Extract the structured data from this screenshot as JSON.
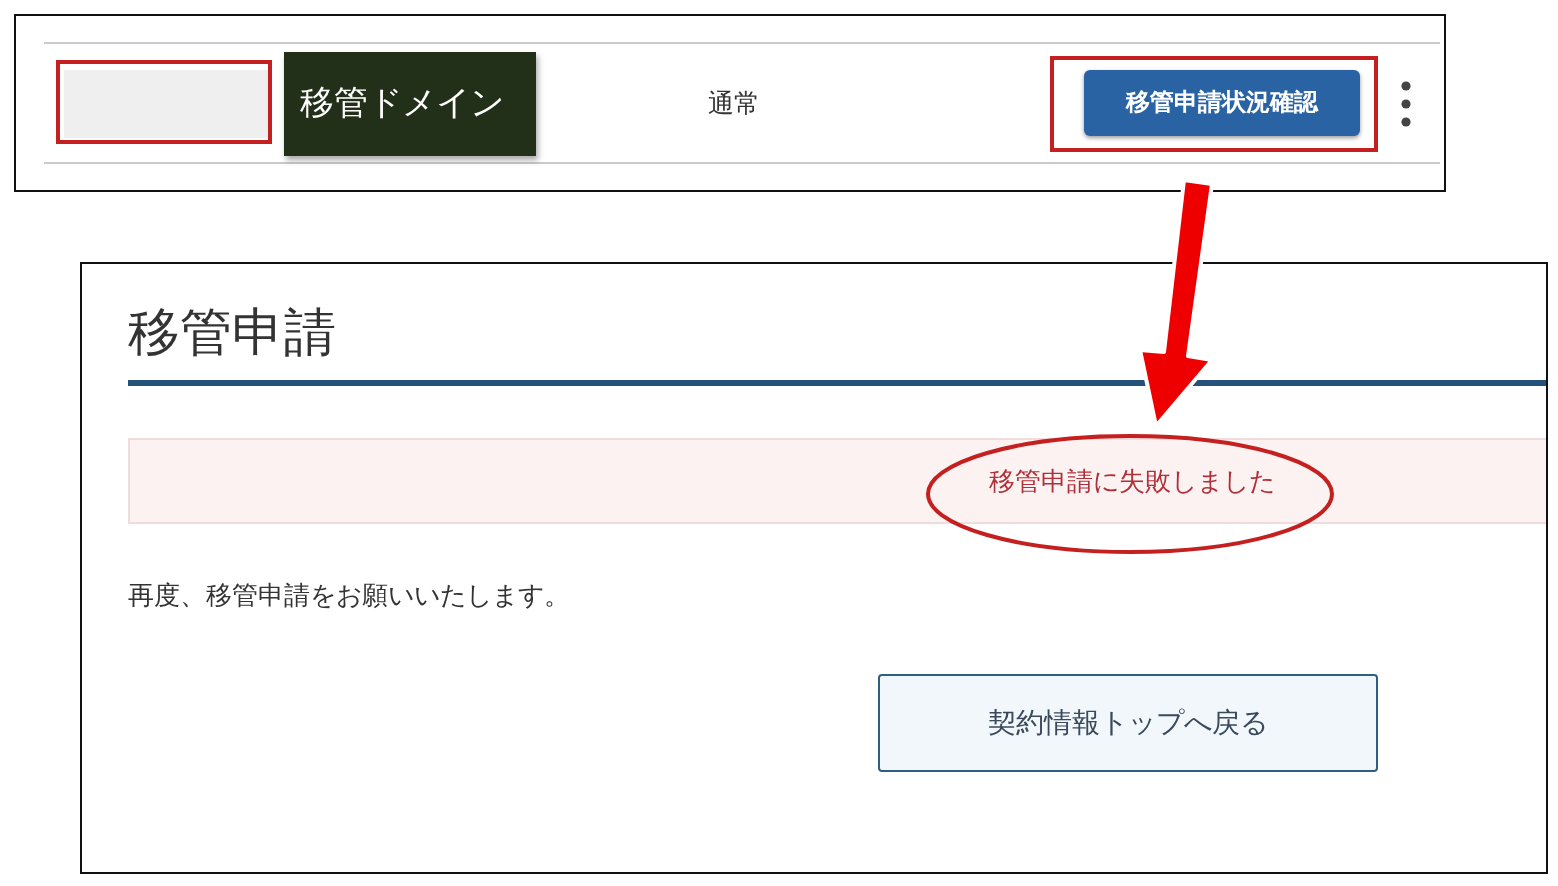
{
  "domain_row": {
    "domain_label": "移管ドメイン",
    "status": "通常",
    "status_button": "移管申請状況確認"
  },
  "transfer_result": {
    "title": "移管申請",
    "alert": "移管申請に失敗しました",
    "message": "再度、移管申請をお願いいたします。",
    "back_button": "契約情報トップへ戻る"
  }
}
